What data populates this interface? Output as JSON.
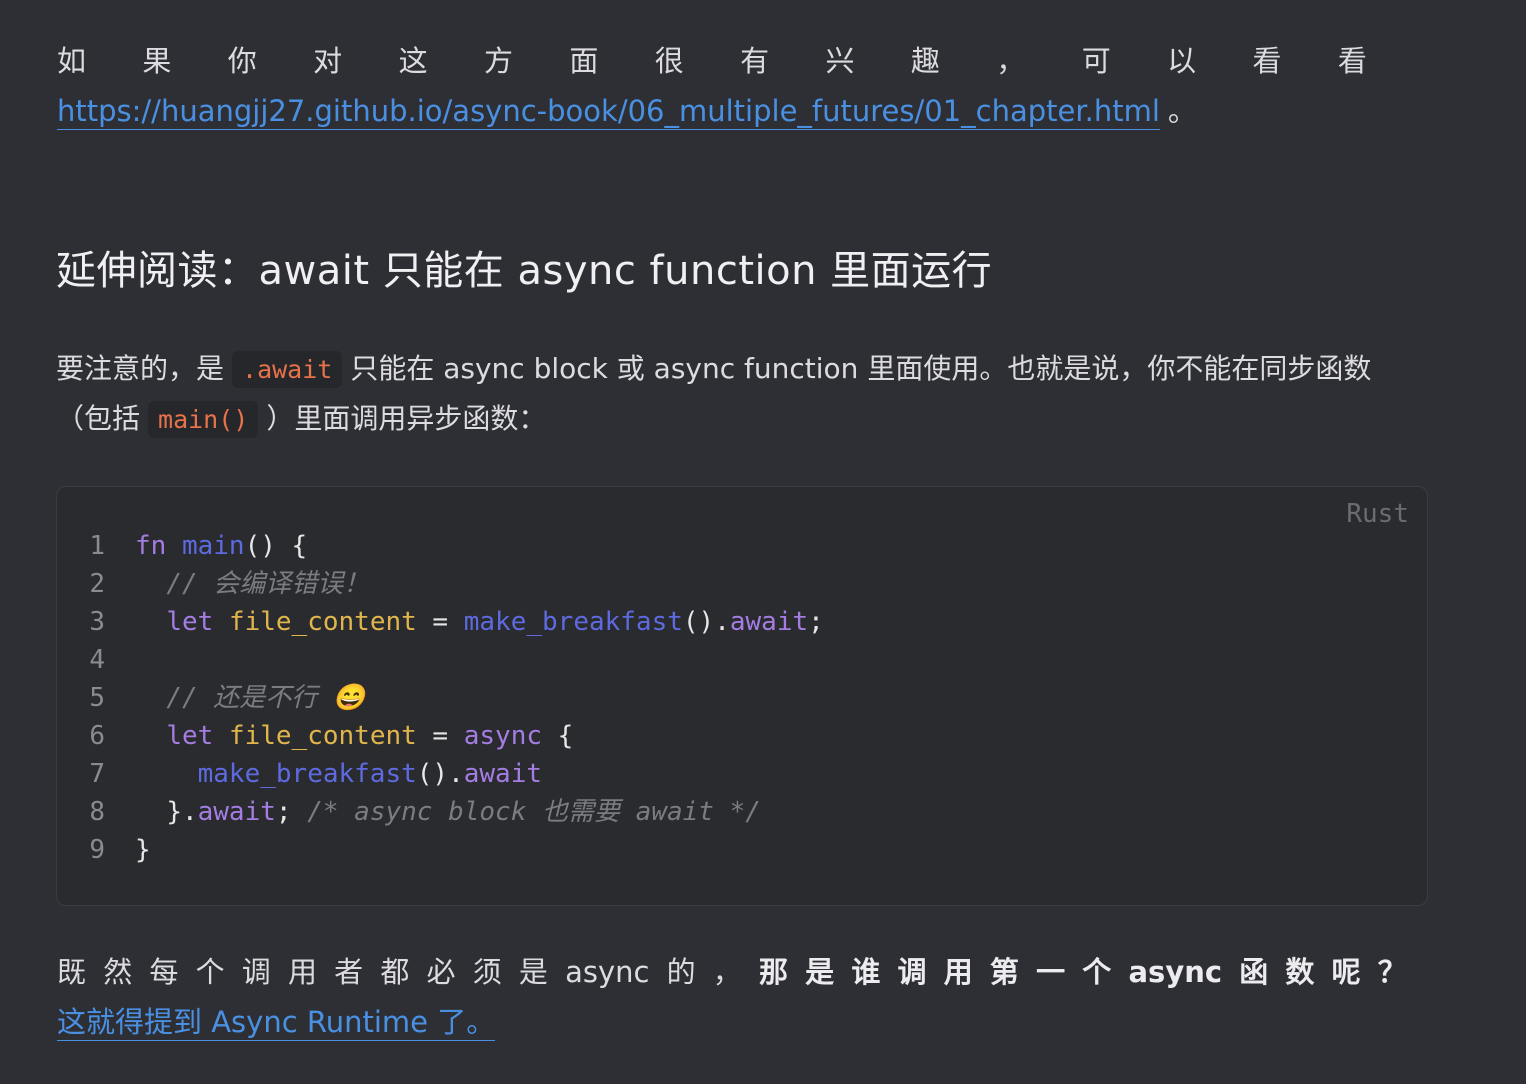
{
  "top_paragraph": {
    "chars": [
      "如",
      "果",
      "你",
      "对",
      "这",
      "方",
      "面",
      "很",
      "有",
      "兴",
      "趣",
      "，",
      "可",
      "以",
      "看",
      "看"
    ],
    "link_text": "https://huangjj27.github.io/async-book/06_multiple_futures/01_chapter.html",
    "trailing": "。"
  },
  "section_title": "延伸阅读：await 只能在 async function 里面运行",
  "mid_paragraph": {
    "line1_before": "要注意的，是",
    "line1_code": ".await",
    "line1_after": "只能在 async block 或 async function 里面使用。也就是说，你不能在同步函数",
    "line2_before": "（包括",
    "line2_code": "main()",
    "line2_after": "）里面调用异步函数："
  },
  "code_block": {
    "language": "Rust",
    "line_numbers": [
      "1",
      "2",
      "3",
      "4",
      "5",
      "6",
      "7",
      "8",
      "9"
    ],
    "tokens": {
      "fn": "fn",
      "main": "main",
      "open": "() {",
      "comment1": "// 会编译错误！",
      "let": "let",
      "file_content": "file_content",
      "eq": " = ",
      "make_breakfast": "make_breakfast",
      "call_dot": "().",
      "await": "await",
      "semi": ";",
      "comment2": "// 还是不行 😄",
      "async": "async",
      "brace_open": " {",
      "close_dot": "}.",
      "comment3": "/* async block 也需要 await */",
      "close": "}"
    }
  },
  "bottom_paragraph": {
    "normal_chars": [
      "既",
      "然",
      "每",
      "个",
      "调",
      "用",
      "者",
      "都",
      "必",
      "须",
      "是",
      "async",
      "的",
      "，"
    ],
    "bold_chars": [
      "那",
      "是",
      "谁",
      "调",
      "用",
      "第",
      "一",
      "个",
      "async",
      "函",
      "数",
      "呢",
      "？"
    ],
    "link_text": "这就得提到 Async Runtime 了。"
  }
}
